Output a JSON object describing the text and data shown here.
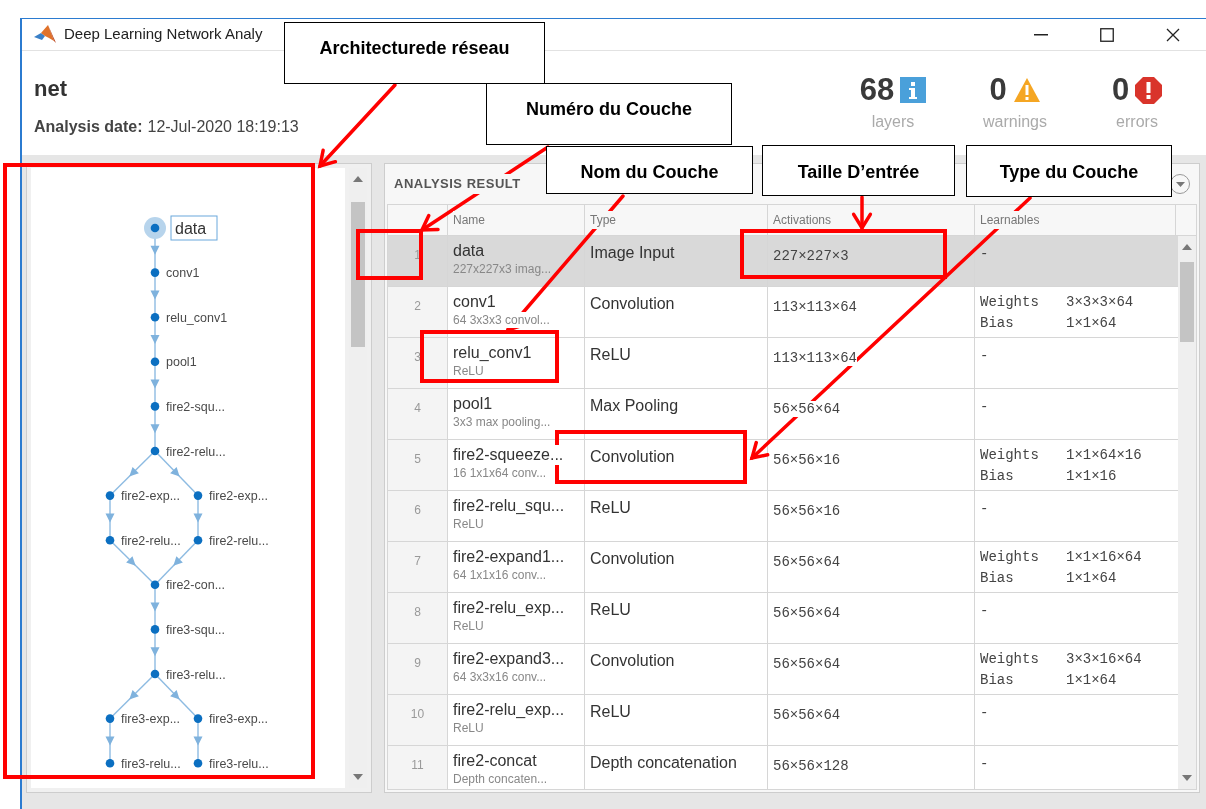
{
  "window": {
    "title": "Deep Learning Network Analy"
  },
  "header": {
    "name": "net",
    "date_label": "Analysis date:",
    "date": "12-Jul-2020 18:19:13"
  },
  "stats": [
    {
      "kind": "info",
      "count": "68",
      "label": "layers"
    },
    {
      "kind": "warning",
      "count": "0",
      "label": "warnings"
    },
    {
      "kind": "error",
      "count": "0",
      "label": "errors"
    }
  ],
  "graph": {
    "rows": [
      {
        "nodes": [
          {
            "label": "data",
            "selected": true
          }
        ]
      },
      {
        "nodes": [
          {
            "label": "conv1",
            "selected": false
          }
        ]
      },
      {
        "nodes": [
          {
            "label": "relu_conv1",
            "selected": false
          }
        ]
      },
      {
        "nodes": [
          {
            "label": "pool1",
            "selected": false
          }
        ]
      },
      {
        "nodes": [
          {
            "label": "fire2-squ...",
            "selected": false
          }
        ]
      },
      {
        "nodes": [
          {
            "label": "fire2-relu...",
            "selected": false
          }
        ]
      },
      {
        "nodes": [
          {
            "label": "fire2-exp...",
            "selected": false
          },
          {
            "label": "fire2-exp...",
            "selected": false
          }
        ]
      },
      {
        "nodes": [
          {
            "label": "fire2-relu...",
            "selected": false
          },
          {
            "label": "fire2-relu...",
            "selected": false
          }
        ]
      },
      {
        "nodes": [
          {
            "label": "fire2-con...",
            "selected": false
          }
        ]
      },
      {
        "nodes": [
          {
            "label": "fire3-squ...",
            "selected": false
          }
        ]
      },
      {
        "nodes": [
          {
            "label": "fire3-relu...",
            "selected": false
          }
        ]
      },
      {
        "nodes": [
          {
            "label": "fire3-exp...",
            "selected": false
          },
          {
            "label": "fire3-exp...",
            "selected": false
          }
        ]
      },
      {
        "nodes": [
          {
            "label": "fire3-relu...",
            "selected": false
          },
          {
            "label": "fire3-relu...",
            "selected": false
          }
        ]
      }
    ]
  },
  "results": {
    "title": "ANALYSIS RESULT",
    "columns": [
      "Name",
      "Type",
      "Activations",
      "Learnables"
    ],
    "rows": [
      {
        "number": "1",
        "name": "data",
        "detail": "227x227x3 imag...",
        "type": "Image Input",
        "activations": "227×227×3",
        "learnables": "-",
        "selected": true
      },
      {
        "number": "2",
        "name": "conv1",
        "detail": "64 3x3x3 convol...",
        "type": "Convolution",
        "activations": "113×113×64",
        "learnables": [
          {
            "name": "Weights",
            "value": "3×3×3×64"
          },
          {
            "name": "Bias",
            "value": "1×1×64"
          }
        ],
        "selected": false
      },
      {
        "number": "3",
        "name": "relu_conv1",
        "detail": "ReLU",
        "type": "ReLU",
        "activations": "113×113×64",
        "learnables": "-",
        "selected": false
      },
      {
        "number": "4",
        "name": "pool1",
        "detail": "3x3 max pooling...",
        "type": "Max Pooling",
        "activations": "56×56×64",
        "learnables": "-",
        "selected": false
      },
      {
        "number": "5",
        "name": "fire2-squeeze...",
        "detail": "16 1x1x64 conv...",
        "type": "Convolution",
        "activations": "56×56×16",
        "learnables": [
          {
            "name": "Weights",
            "value": "1×1×64×16"
          },
          {
            "name": "Bias",
            "value": "1×1×16"
          }
        ],
        "selected": false
      },
      {
        "number": "6",
        "name": "fire2-relu_squ...",
        "detail": "ReLU",
        "type": "ReLU",
        "activations": "56×56×16",
        "learnables": "-",
        "selected": false
      },
      {
        "number": "7",
        "name": "fire2-expand1...",
        "detail": "64 1x1x16 conv...",
        "type": "Convolution",
        "activations": "56×56×64",
        "learnables": [
          {
            "name": "Weights",
            "value": "1×1×16×64"
          },
          {
            "name": "Bias",
            "value": "1×1×64"
          }
        ],
        "selected": false
      },
      {
        "number": "8",
        "name": "fire2-relu_exp...",
        "detail": "ReLU",
        "type": "ReLU",
        "activations": "56×56×64",
        "learnables": "-",
        "selected": false
      },
      {
        "number": "9",
        "name": "fire2-expand3...",
        "detail": "64 3x3x16 conv...",
        "type": "Convolution",
        "activations": "56×56×64",
        "learnables": [
          {
            "name": "Weights",
            "value": "3×3×16×64"
          },
          {
            "name": "Bias",
            "value": "1×1×64"
          }
        ],
        "selected": false
      },
      {
        "number": "10",
        "name": "fire2-relu_exp...",
        "detail": "ReLU",
        "type": "ReLU",
        "activations": "56×56×64",
        "learnables": "-",
        "selected": false
      },
      {
        "number": "11",
        "name": "fire2-concat",
        "detail": "Depth concaten...",
        "type": "Depth concatenation",
        "activations": "56×56×128",
        "learnables": "-",
        "selected": false
      }
    ]
  },
  "annotations": [
    {
      "text": "Architecturede réseau"
    },
    {
      "text": "Numéro du Couche"
    },
    {
      "text": "Nom du Couche"
    },
    {
      "text": "Taille D’entrée"
    },
    {
      "text": "Type du Couche"
    }
  ]
}
